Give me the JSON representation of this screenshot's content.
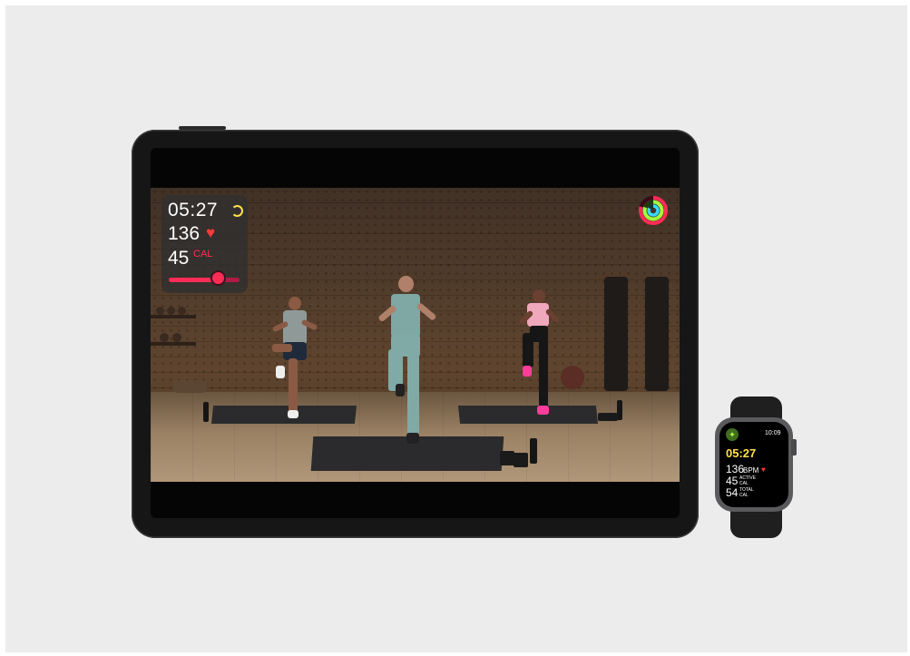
{
  "ipad": {
    "metrics": {
      "elapsed_time": "05:27",
      "heart_rate": "136",
      "heart_icon": "heart-icon",
      "calories": "45",
      "calories_unit": "CAL",
      "burn_bar_level_fraction": 0.7
    },
    "activity_rings_icon": "activity-rings-icon",
    "colors": {
      "move": "#ff2d55",
      "exercise": "#a4ff3c",
      "stand": "#3ad8ff",
      "time_ring": "#ffe14a"
    }
  },
  "watch": {
    "workout_icon": "running-figure-icon",
    "clock": "10:09",
    "elapsed_time": "05:27",
    "heart_rate": "136",
    "heart_rate_unit": "BPM",
    "active_calories": "45",
    "active_calories_unit_line1": "ACTIVE",
    "active_calories_unit_line2": "CAL",
    "total_calories": "54",
    "total_calories_unit_line1": "TOTAL",
    "total_calories_unit_line2": "CAL"
  }
}
